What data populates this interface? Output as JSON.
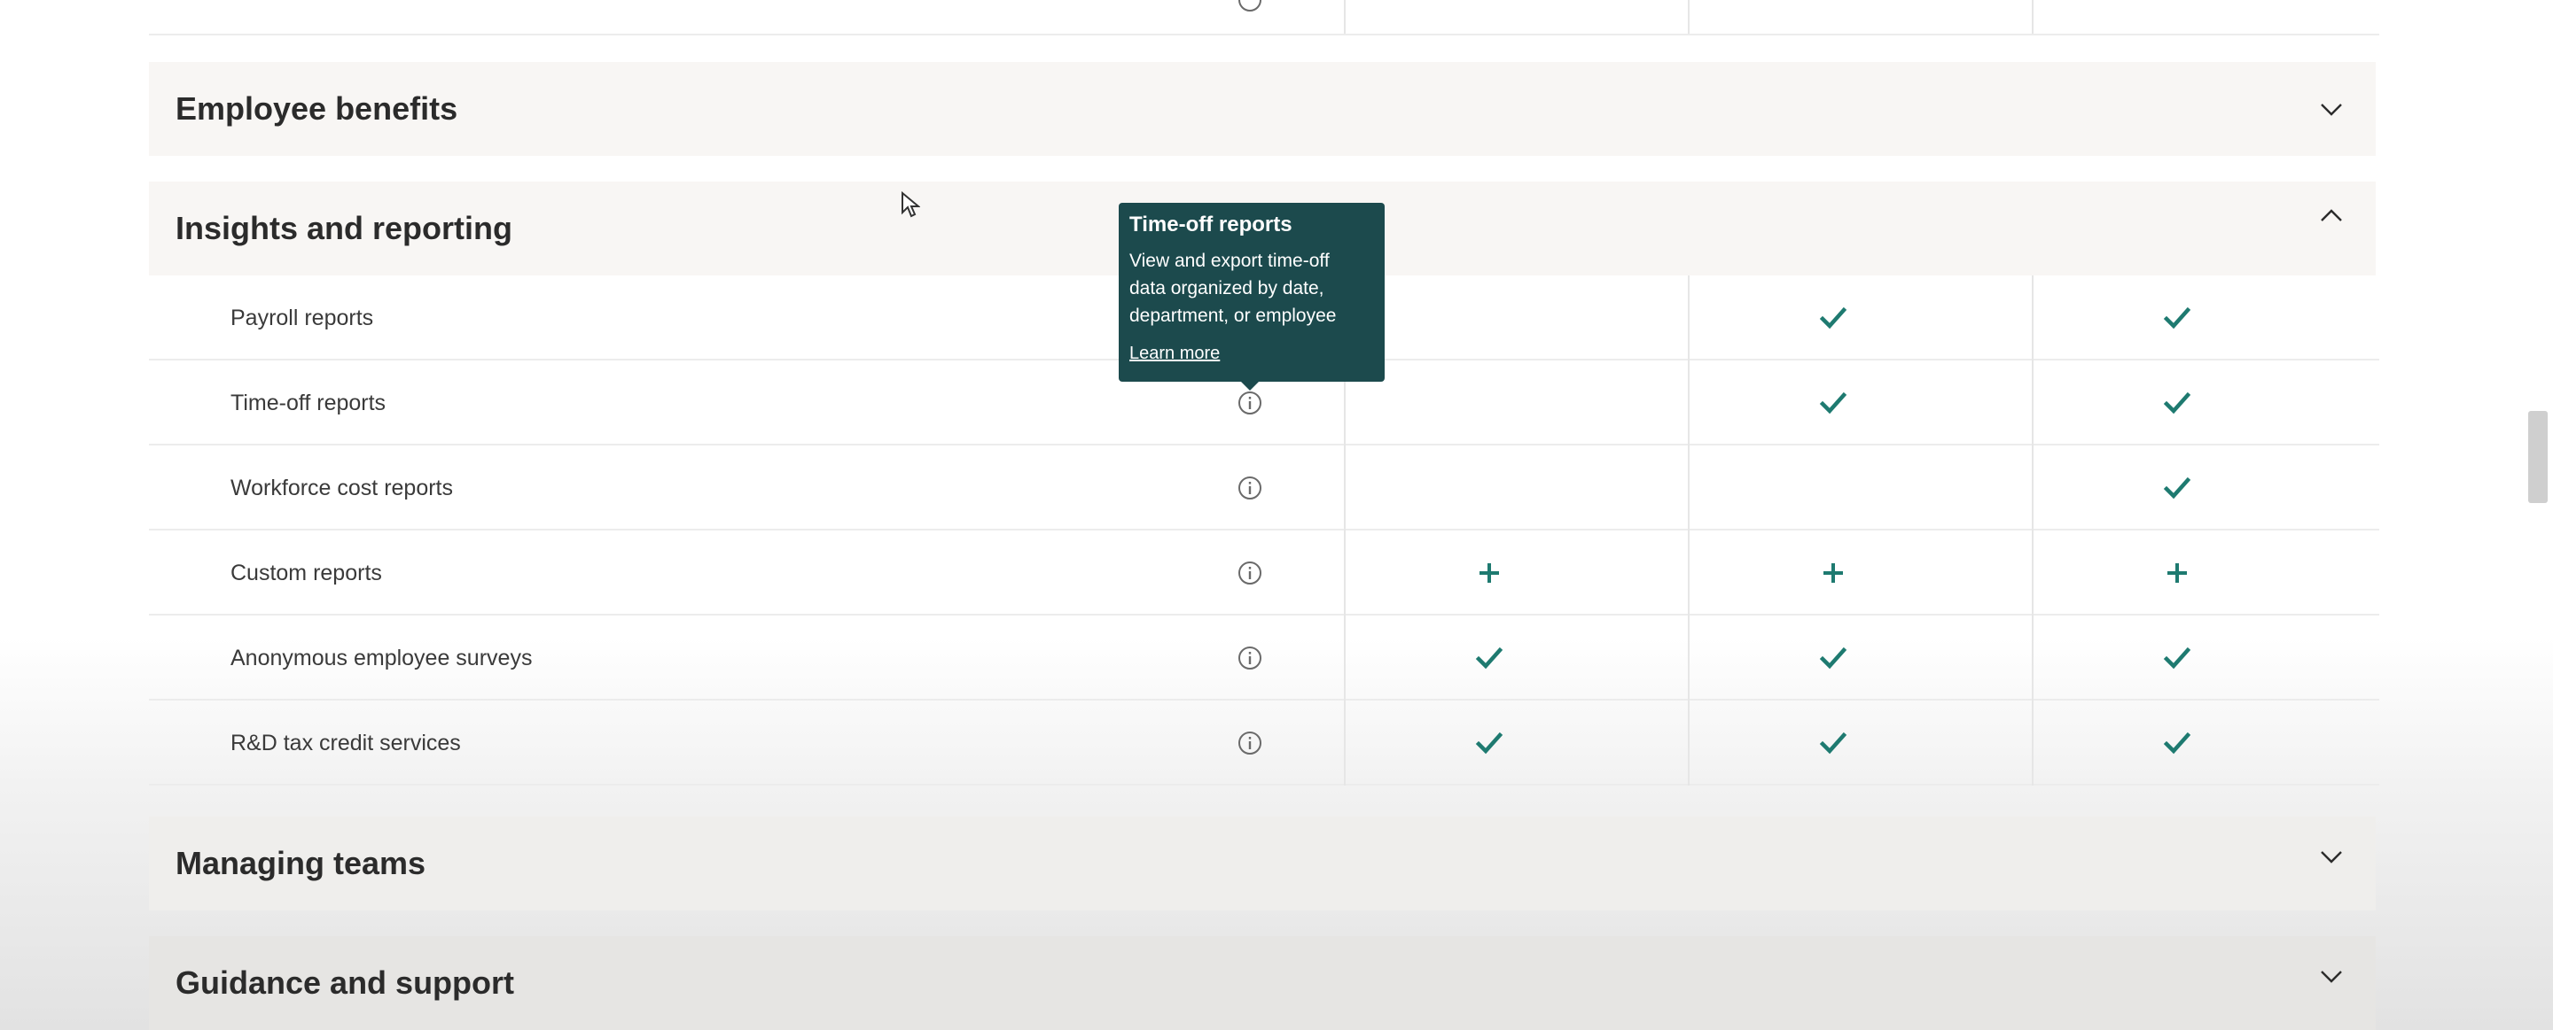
{
  "sections": {
    "employee_benefits": {
      "title": "Employee benefits",
      "state": "collapsed"
    },
    "insights_reporting": {
      "title": "Insights and reporting",
      "state": "expanded"
    },
    "managing_teams": {
      "title": "Managing teams",
      "state": "collapsed"
    },
    "guidance_support": {
      "title": "Guidance and support",
      "state": "collapsed"
    }
  },
  "rows": [
    {
      "label": "Payroll reports",
      "marks": [
        "none",
        "check",
        "check"
      ]
    },
    {
      "label": "Time-off reports",
      "marks": [
        "none",
        "check",
        "check"
      ]
    },
    {
      "label": "Workforce cost reports",
      "marks": [
        "none",
        "none",
        "check"
      ]
    },
    {
      "label": "Custom reports",
      "marks": [
        "plus",
        "plus",
        "plus"
      ]
    },
    {
      "label": "Anonymous employee surveys",
      "marks": [
        "check",
        "check",
        "check"
      ]
    },
    {
      "label": "R&D tax credit services",
      "marks": [
        "check",
        "check",
        "check"
      ]
    }
  ],
  "tooltip": {
    "title": "Time-off reports",
    "body": "View and export time-off data organized by date, department, or employee",
    "link": "Learn more"
  },
  "icons": {
    "info": "info-icon",
    "check": "check-icon",
    "plus": "plus-icon",
    "chevron_down": "chevron-down-icon",
    "chevron_up": "chevron-up-icon"
  },
  "colors": {
    "accent_teal": "#1e7a70",
    "tooltip_bg": "#1c4a4d",
    "section_bg": "#f8f6f4"
  }
}
